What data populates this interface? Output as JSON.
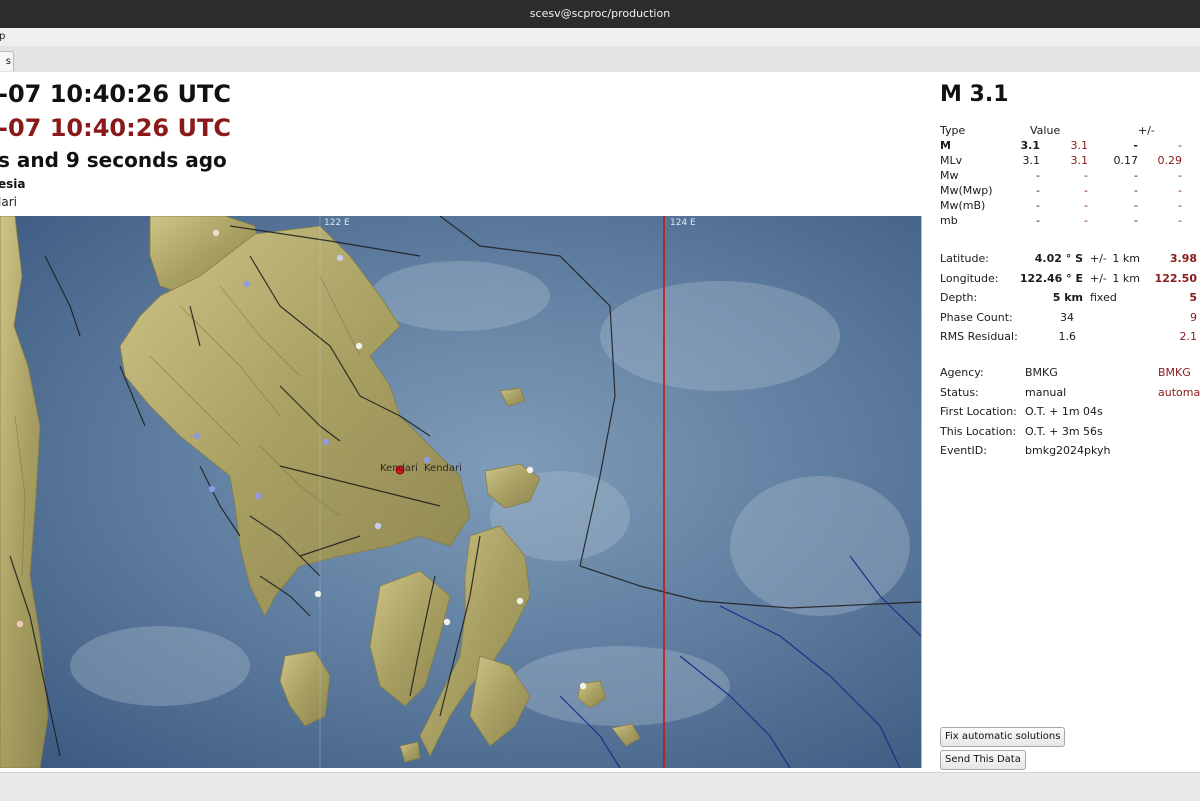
{
  "window": {
    "title": "scesv@scproc/production"
  },
  "menu": {
    "partial_label": "p"
  },
  "tab": {
    "partial_label": "s"
  },
  "event": {
    "time_primary": "-07 10:40:26 UTC",
    "time_secondary": "-07 10:40:26 UTC",
    "ago": "s and 9 seconds ago",
    "region": "esia",
    "city_partial": "lari"
  },
  "map": {
    "lon_labels": [
      "122 E",
      "124 E"
    ],
    "city_labels": [
      "Kendari",
      "Kendari"
    ],
    "epicenter_color": "#e0141e",
    "meridian_color": "#cc1111",
    "sea_color": "#5f7d9c",
    "land_color": "#b6ac6c"
  },
  "magnitude": {
    "headline": "M 3.1",
    "header": {
      "type": "Type",
      "value": "Value",
      "pm": "+/-"
    },
    "rows": [
      {
        "type": "M",
        "value": "3.1",
        "value2": "3.1",
        "unc": "-",
        "unc2": "-"
      },
      {
        "type": "MLv",
        "value": "3.1",
        "value2": "3.1",
        "unc": "0.17",
        "unc2": "0.29"
      },
      {
        "type": "Mw",
        "value": "-",
        "value2": "-",
        "unc": "-",
        "unc2": "-"
      },
      {
        "type": "Mw(Mwp)",
        "value": "-",
        "value2": "-",
        "unc": "-",
        "unc2": "-"
      },
      {
        "type": "Mw(mB)",
        "value": "-",
        "value2": "-",
        "unc": "-",
        "unc2": "-"
      },
      {
        "type": "mb",
        "value": "-",
        "value2": "-",
        "unc": "-",
        "unc2": "-"
      }
    ]
  },
  "location": [
    {
      "label": "Latitude:",
      "value": "4.02 ° S",
      "pm": "+/-",
      "unc": "1 km",
      "value2": "3.98"
    },
    {
      "label": "Longitude:",
      "value": "122.46 ° E",
      "pm": "+/-",
      "unc": "1 km",
      "value2": "122.50"
    },
    {
      "label": "Depth:",
      "value": "5 km",
      "pm": "fixed",
      "unc": "",
      "value2": "5"
    },
    {
      "label": "Phase Count:",
      "value": "34",
      "pm": "",
      "unc": "",
      "value2": "9"
    },
    {
      "label": "RMS Residual:",
      "value": "1.6",
      "pm": "",
      "unc": "",
      "value2": "2.1"
    }
  ],
  "info": [
    {
      "label": "Agency:",
      "value": "BMKG",
      "value2": "BMKG"
    },
    {
      "label": "Status:",
      "value": "manual",
      "value2": "automa"
    },
    {
      "label": "First Location:",
      "value": "O.T. + 1m 04s",
      "value2": ""
    },
    {
      "label": "This Location:",
      "value": "O.T. + 3m 56s",
      "value2": ""
    },
    {
      "label": "EventID:",
      "value": "bmkg2024pkyh",
      "value2": ""
    }
  ],
  "buttons": {
    "fix_label": "Fix automatic solutions",
    "send_label": "Send This Data"
  }
}
